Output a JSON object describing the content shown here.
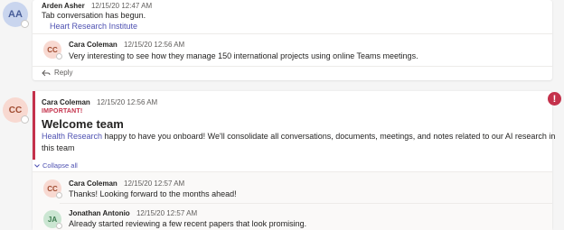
{
  "thread1": {
    "avatar_initials": "AA",
    "author": "Arden Asher",
    "timestamp": "12/15/20 12:47 AM",
    "message": "Tab conversation has begun.",
    "link_text": "Heart Research Institute",
    "reply": {
      "avatar_initials": "CC",
      "author": "Cara Coleman",
      "timestamp": "12/15/20 12:56 AM",
      "message": "Very interesting to see how they manage 150 international projects using online Teams meetings."
    },
    "reply_label": "Reply"
  },
  "thread2": {
    "avatar_initials": "CC",
    "author": "Cara Coleman",
    "timestamp": "12/15/20 12:56 AM",
    "importance_label": "IMPORTANT!",
    "title": "Welcome team",
    "mention": "Health Research",
    "message_line1": " happy to have you onboard! We'll consolidate all conversations, documents, meetings, and notes related to our AI research in",
    "message_line2": "this team",
    "alert_icon_glyph": "!",
    "collapse_label": "Collapse all",
    "replies": [
      {
        "avatar_initials": "CC",
        "author": "Cara Coleman",
        "timestamp": "12/15/20 12:57 AM",
        "message": "Thanks! Looking forward to the months ahead!"
      },
      {
        "avatar_initials": "JA",
        "author": "Jonathan Antonio",
        "timestamp": "12/15/20 12:57 AM",
        "message": "Already started reviewing a few recent papers that look promising."
      }
    ]
  },
  "colors": {
    "accent": "#4f52b2",
    "important": "#c4314b",
    "background": "#f5f5f5"
  }
}
